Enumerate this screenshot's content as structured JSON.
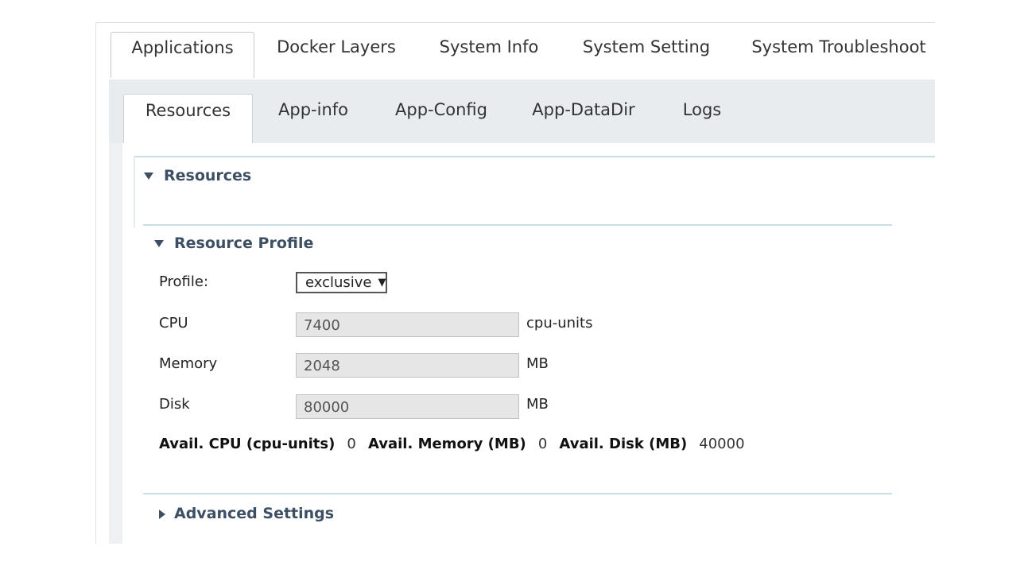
{
  "top_tabs": [
    {
      "label": "Applications",
      "active": true
    },
    {
      "label": "Docker Layers",
      "active": false
    },
    {
      "label": "System Info",
      "active": false
    },
    {
      "label": "System Setting",
      "active": false
    },
    {
      "label": "System Troubleshoot",
      "active": false
    }
  ],
  "sub_tabs": [
    {
      "label": "Resources",
      "active": true
    },
    {
      "label": "App-info",
      "active": false
    },
    {
      "label": "App-Config",
      "active": false
    },
    {
      "label": "App-DataDir",
      "active": false
    },
    {
      "label": "Logs",
      "active": false
    }
  ],
  "resources_section": {
    "title": "Resources",
    "expanded": true
  },
  "profile_section": {
    "title": "Resource Profile",
    "expanded": true
  },
  "profile": {
    "label": "Profile:",
    "selected": "exclusive"
  },
  "cpu": {
    "label": "CPU",
    "value": "7400",
    "unit": "cpu-units"
  },
  "memory": {
    "label": "Memory",
    "value": "2048",
    "unit": "MB"
  },
  "disk": {
    "label": "Disk",
    "value": "80000",
    "unit": "MB"
  },
  "avail": {
    "cpu_label": "Avail. CPU (cpu-units)",
    "cpu_value": "0",
    "memory_label": "Avail. Memory (MB)",
    "memory_value": "0",
    "disk_label": "Avail. Disk (MB)",
    "disk_value": "40000"
  },
  "advanced_section": {
    "title": "Advanced Settings",
    "expanded": false
  },
  "colors": {
    "section_title": "#3d4f63",
    "tab_bar": "#e9ecef",
    "divider": "#c9dde4",
    "readonly_bg": "#e6e6e6"
  }
}
